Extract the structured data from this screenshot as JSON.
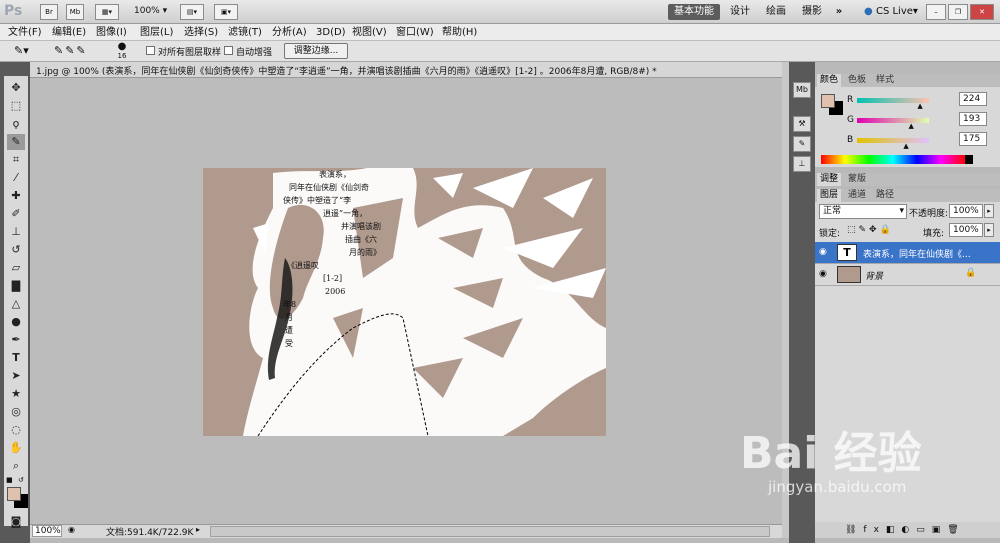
{
  "appbar": {
    "logo": "Ps",
    "btn_br": "Br",
    "btn_mb": "Mb",
    "zoom": "100%",
    "workspaces": [
      "基本功能",
      "设计",
      "绘画",
      "摄影"
    ],
    "more": "»",
    "cs_live": "CS Live"
  },
  "menus": [
    "文件(F)",
    "编辑(E)",
    "图像(I)",
    "图层(L)",
    "选择(S)",
    "滤镜(T)",
    "分析(A)",
    "3D(D)",
    "视图(V)",
    "窗口(W)",
    "帮助(H)"
  ],
  "options": {
    "brush_size": "16",
    "sample_all_layers": "对所有图层取样",
    "auto_enhance": "自动增强",
    "refine_edge": "调整边缘..."
  },
  "document": {
    "tab_title": "1.jpg @ 100% (表演系，同年在仙侠剧《仙剑奇侠传》中塑造了“李逍遥”一角，并演唱该剧插曲《六月的雨》《逍遥叹》[1-2] 。2006年8月遭, RGB/8#) *",
    "overlay_lines": [
      "表演系，",
      "同年在仙侠剧《仙剑奇",
      "侠传》中塑造了“李",
      "逍遥”一角，",
      "并演唱该剧",
      "插曲《六",
      "月的雨》",
      "《逍遥叹",
      "[1-2]",
      "2006",
      "年8",
      "月",
      "遭",
      "受"
    ],
    "zoom": "100%",
    "doc_size": "文档:591.4K/722.9K"
  },
  "color_panel": {
    "tabs": [
      "颜色",
      "色板",
      "样式"
    ],
    "r_label": "R",
    "g_label": "G",
    "b_label": "B",
    "r": "224",
    "g": "193",
    "b": "175",
    "r_fraction": 0.88,
    "g_fraction": 0.757,
    "b_fraction": 0.686,
    "fg_color": "#e0c1af",
    "bg_color": "#000000"
  },
  "adjust_panel": {
    "tabs": [
      "调整",
      "蒙版"
    ]
  },
  "layers_panel": {
    "tabs": [
      "图层",
      "通道",
      "路径"
    ],
    "blend_mode": "正常",
    "opacity_label": "不透明度:",
    "opacity": "100%",
    "lock_label": "锁定:",
    "fill_label": "填充:",
    "fill": "100%",
    "layers": [
      {
        "name": "表演系，同年在仙侠剧《...",
        "type": "T",
        "selected": true
      },
      {
        "name": "背景",
        "type": "image",
        "selected": false
      }
    ]
  },
  "watermark": {
    "brand": "Bai 经验",
    "url": "jingyan.baidu.com"
  },
  "colors": {
    "accent": "#3a74c9",
    "canvas_bg": "#b09a8d"
  }
}
